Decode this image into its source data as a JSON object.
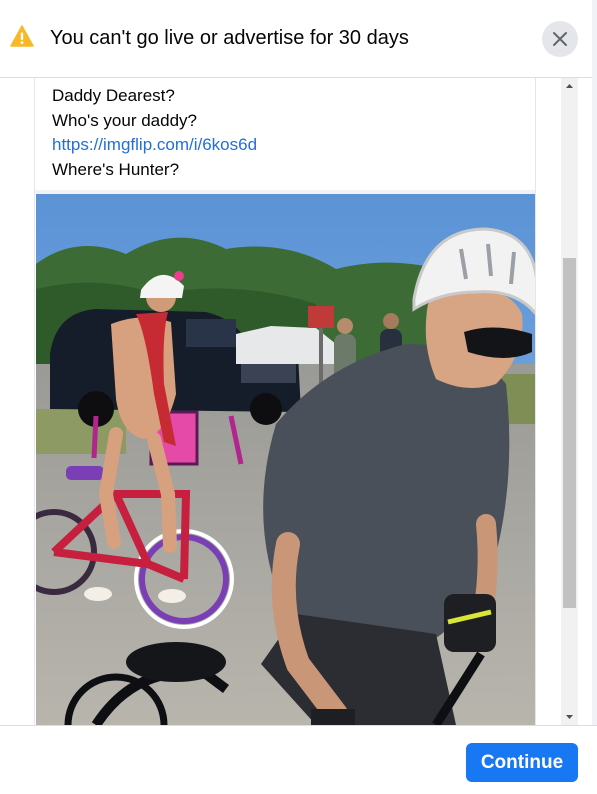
{
  "header": {
    "title": "You can't go live or advertise for 30 days",
    "warning_icon": "warning-triangle-icon",
    "close_icon": "close-icon",
    "warning_color": "#f7b928"
  },
  "post": {
    "lines": [
      "Daddy Dearest?",
      "Who's your daddy?",
      "https://imgflip.com/i/6kos6d",
      "Where's Hunter?"
    ],
    "link_color": "#216fdb"
  },
  "footer": {
    "continue_label": "Continue",
    "button_color": "#1877f2"
  }
}
